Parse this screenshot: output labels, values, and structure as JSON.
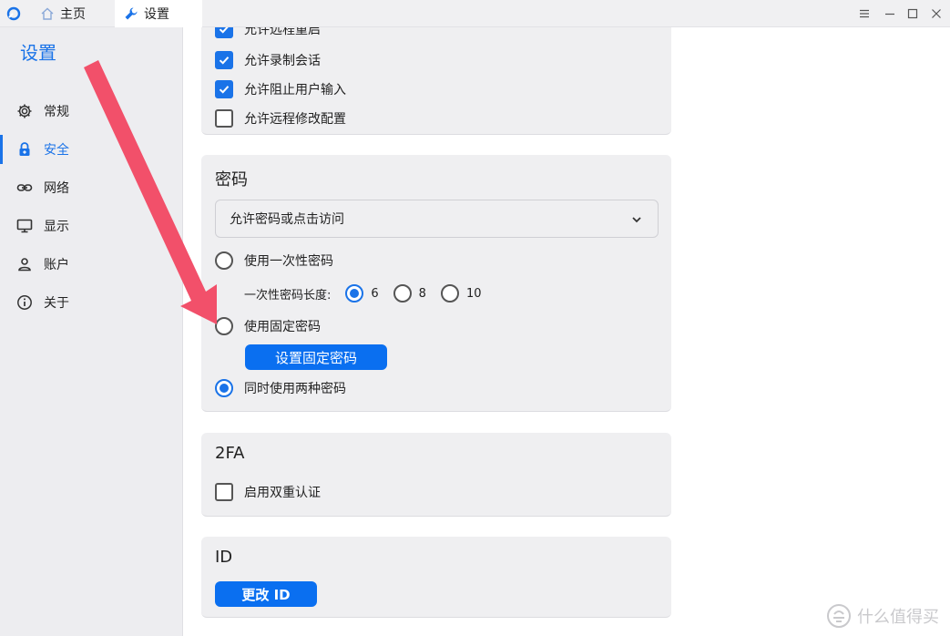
{
  "titlebar": {
    "tabs": [
      {
        "label": "主页",
        "icon": "home-icon"
      },
      {
        "label": "设置",
        "icon": "wrench-icon"
      }
    ]
  },
  "sidebar": {
    "title": "设置",
    "items": [
      {
        "label": "常规",
        "icon": "gear-icon",
        "active": false
      },
      {
        "label": "安全",
        "icon": "lock-icon",
        "active": true
      },
      {
        "label": "网络",
        "icon": "link-icon",
        "active": false
      },
      {
        "label": "显示",
        "icon": "monitor-icon",
        "active": false
      },
      {
        "label": "账户",
        "icon": "person-icon",
        "active": false
      },
      {
        "label": "关于",
        "icon": "info-icon",
        "active": false
      }
    ]
  },
  "permissions": {
    "partial_item": "允许远程重启",
    "items": [
      {
        "label": "允许录制会话",
        "checked": true
      },
      {
        "label": "允许阻止用户输入",
        "checked": true
      },
      {
        "label": "允许远程修改配置",
        "checked": false
      }
    ]
  },
  "password": {
    "title": "密码",
    "access_mode": "允许密码或点击访问",
    "one_time": {
      "label": "使用一次性密码",
      "selected": false
    },
    "length_label": "一次性密码长度:",
    "length_options": [
      {
        "label": "6",
        "selected": true
      },
      {
        "label": "8",
        "selected": false
      },
      {
        "label": "10",
        "selected": false
      }
    ],
    "fixed": {
      "label": "使用固定密码",
      "selected": false
    },
    "set_fixed_button": "设置固定密码",
    "both": {
      "label": "同时使用两种密码",
      "selected": true
    }
  },
  "twofa": {
    "title": "2FA",
    "enable": {
      "label": "启用双重认证",
      "checked": false
    }
  },
  "id_section": {
    "title": "ID",
    "change_button": "更改 ID"
  },
  "watermark": "什么值得买",
  "colors": {
    "accent": "#1a73e8",
    "button": "#0a6ff0",
    "arrow": "#f2506a"
  }
}
